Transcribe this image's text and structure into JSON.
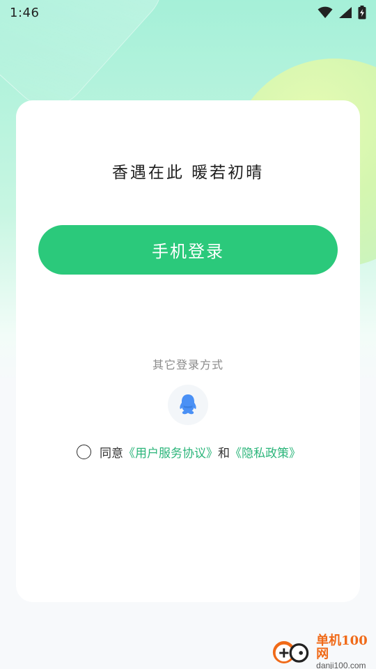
{
  "status_bar": {
    "time": "1:46",
    "icons": [
      "wifi-icon",
      "signal-icon",
      "battery-charging-icon"
    ]
  },
  "colors": {
    "accent": "#2bc97b",
    "link": "#2bb57a",
    "qq_blue": "#4a90f5",
    "watermark_orange": "#f06a18"
  },
  "main": {
    "slogan": "香遇在此 暖若初晴",
    "phone_login_label": "手机登录",
    "other_methods_label": "其它登录方式",
    "other_methods": [
      "qq-icon"
    ]
  },
  "agreement": {
    "prefix": "同意",
    "terms_link": "《用户服务协议》",
    "conjunction": "和",
    "privacy_link": "《隐私政策》"
  },
  "watermark": {
    "main": "单机100网",
    "sub": "danji100.com"
  }
}
